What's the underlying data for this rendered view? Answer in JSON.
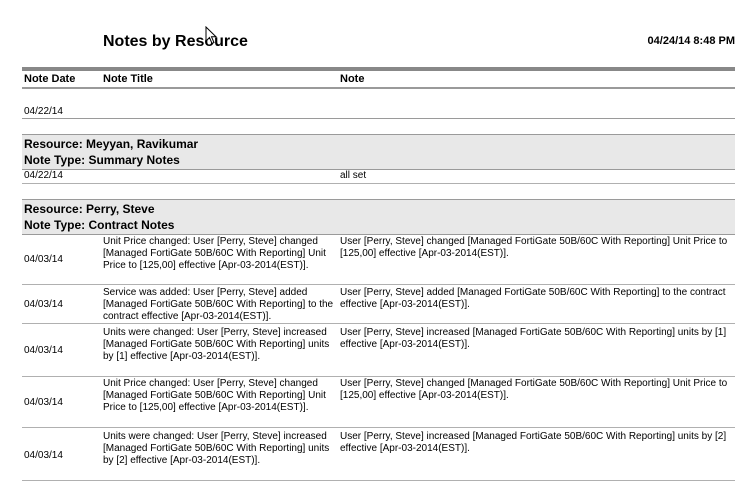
{
  "header": {
    "title": "Notes by Resource",
    "timestamp": "04/24/14 8:48 PM"
  },
  "columns": {
    "date": "Note Date",
    "title": "Note Title",
    "note": "Note"
  },
  "orphan_row": {
    "date": "04/22/14"
  },
  "groups": [
    {
      "resource": "Resource: Meyyan, Ravikumar",
      "note_type": "Note Type: Summary Notes",
      "rows": [
        {
          "date": "04/22/14",
          "title": "",
          "note": "all set"
        }
      ]
    },
    {
      "resource": "Resource: Perry, Steve",
      "note_type": "Note Type: Contract Notes",
      "rows": [
        {
          "date": "04/03/14",
          "title": "Unit Price changed: User [Perry, Steve] changed [Managed FortiGate 50B/60C With Reporting] Unit Price to [125,00] effective [Apr-03-2014(EST)].",
          "note": "User [Perry, Steve] changed [Managed FortiGate 50B/60C With Reporting] Unit Price to [125,00] effective [Apr-03-2014(EST)]."
        },
        {
          "date": "04/03/14",
          "title": "Service was added: User [Perry, Steve] added [Managed FortiGate 50B/60C With Reporting] to the contract effective [Apr-03-2014(EST)].",
          "note": "User [Perry, Steve] added [Managed FortiGate 50B/60C With Reporting] to the contract effective [Apr-03-2014(EST)]."
        },
        {
          "date": "04/03/14",
          "title": "Units were changed: User [Perry, Steve] increased [Managed FortiGate 50B/60C With Reporting] units by [1] effective [Apr-03-2014(EST)].",
          "note": "User [Perry, Steve] increased [Managed FortiGate 50B/60C With Reporting] units by [1] effective [Apr-03-2014(EST)]."
        },
        {
          "date": "04/03/14",
          "title": "Unit Price changed: User [Perry, Steve] changed [Managed FortiGate 50B/60C With Reporting] Unit Price to [125,00] effective [Apr-03-2014(EST)].",
          "note": "User [Perry, Steve] changed [Managed FortiGate 50B/60C With Reporting] Unit Price to [125,00] effective [Apr-03-2014(EST)]."
        },
        {
          "date": "04/03/14",
          "title": "Units were changed: User [Perry, Steve] increased [Managed FortiGate 50B/60C With Reporting] units by [2] effective [Apr-03-2014(EST)].",
          "note": "User [Perry, Steve] increased [Managed FortiGate 50B/60C With Reporting] units by [2] effective [Apr-03-2014(EST)]."
        }
      ]
    }
  ]
}
